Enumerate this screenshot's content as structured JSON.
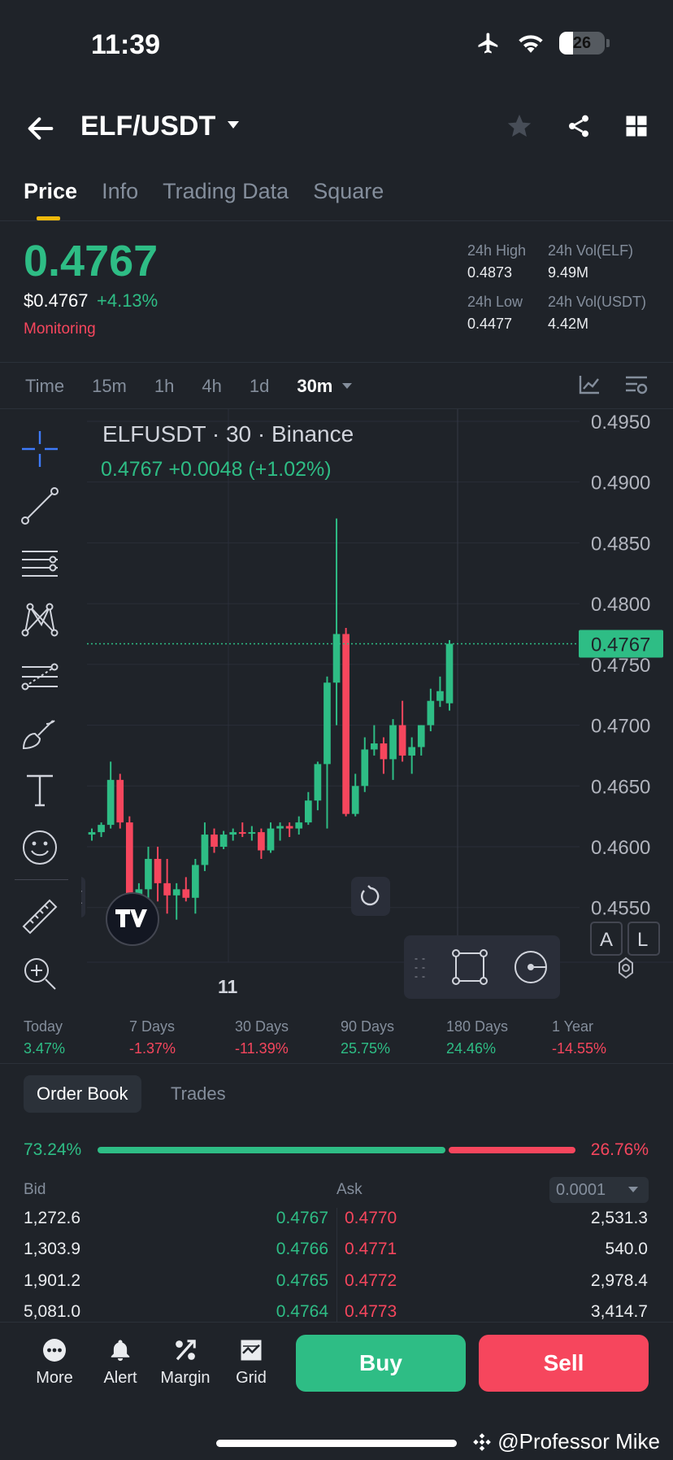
{
  "status": {
    "time": "11:39",
    "battery": "26"
  },
  "header": {
    "pair": "ELF/USDT"
  },
  "tabs": [
    "Price",
    "Info",
    "Trading Data",
    "Square"
  ],
  "price": {
    "last": "0.4767",
    "usd": "$0.4767",
    "change": "+4.13%",
    "monitoring": "Monitoring",
    "high_label": "24h High",
    "high": "0.4873",
    "low_label": "24h Low",
    "low": "0.4477",
    "vol_elf_label": "24h Vol(ELF)",
    "vol_elf": "9.49M",
    "vol_usdt_label": "24h Vol(USDT)",
    "vol_usdt": "4.42M"
  },
  "intervals": [
    "Time",
    "15m",
    "1h",
    "4h",
    "1d",
    "30m"
  ],
  "chart_meta": {
    "title": "ELFUSDT · 30 · Binance",
    "change": "0.4767  +0.0048 (+1.02%)",
    "x_tick": "11",
    "price_tag": "0.4767",
    "btn_a": "A",
    "btn_l": "L"
  },
  "chart_data": {
    "type": "candlestick",
    "title": "ELFUSDT · 30 · Binance",
    "ylim": [
      0.4505,
      0.496
    ],
    "y_ticks": [
      "0.4950",
      "0.4900",
      "0.4850",
      "0.4800",
      "0.4750",
      "0.4700",
      "0.4650",
      "0.4600",
      "0.4550"
    ],
    "x_tick_labels": [
      "11"
    ],
    "last_price": 0.4767,
    "candles": [
      [
        0.461,
        0.4615,
        0.4605,
        0.4612
      ],
      [
        0.4612,
        0.462,
        0.4608,
        0.4618
      ],
      [
        0.4618,
        0.467,
        0.4615,
        0.4655
      ],
      [
        0.4655,
        0.466,
        0.4615,
        0.462
      ],
      [
        0.462,
        0.4625,
        0.453,
        0.4545
      ],
      [
        0.4545,
        0.457,
        0.454,
        0.4565
      ],
      [
        0.4565,
        0.46,
        0.455,
        0.459
      ],
      [
        0.459,
        0.46,
        0.4555,
        0.457
      ],
      [
        0.457,
        0.459,
        0.4545,
        0.456
      ],
      [
        0.456,
        0.457,
        0.454,
        0.4565
      ],
      [
        0.4565,
        0.4575,
        0.4555,
        0.4558
      ],
      [
        0.4558,
        0.459,
        0.4545,
        0.4585
      ],
      [
        0.4585,
        0.462,
        0.458,
        0.461
      ],
      [
        0.461,
        0.4615,
        0.4595,
        0.46
      ],
      [
        0.46,
        0.4613,
        0.4598,
        0.461
      ],
      [
        0.461,
        0.4615,
        0.4605,
        0.4612
      ],
      [
        0.4612,
        0.462,
        0.4608,
        0.4611
      ],
      [
        0.4611,
        0.4617,
        0.4605,
        0.4612
      ],
      [
        0.4612,
        0.4615,
        0.459,
        0.4597
      ],
      [
        0.4597,
        0.462,
        0.4595,
        0.4615
      ],
      [
        0.4615,
        0.462,
        0.4605,
        0.4617
      ],
      [
        0.4617,
        0.462,
        0.4608,
        0.4615
      ],
      [
        0.4615,
        0.4625,
        0.461,
        0.462
      ],
      [
        0.462,
        0.4645,
        0.4618,
        0.4638
      ],
      [
        0.4638,
        0.467,
        0.463,
        0.4668
      ],
      [
        0.4668,
        0.474,
        0.4615,
        0.4735
      ],
      [
        0.4735,
        0.487,
        0.47,
        0.4775
      ],
      [
        0.4775,
        0.478,
        0.4625,
        0.4627
      ],
      [
        0.4627,
        0.466,
        0.4625,
        0.465
      ],
      [
        0.465,
        0.469,
        0.4645,
        0.468
      ],
      [
        0.468,
        0.47,
        0.4675,
        0.4685
      ],
      [
        0.4685,
        0.469,
        0.466,
        0.4672
      ],
      [
        0.4672,
        0.4705,
        0.4655,
        0.47
      ],
      [
        0.47,
        0.472,
        0.467,
        0.4675
      ],
      [
        0.4675,
        0.469,
        0.466,
        0.4682
      ],
      [
        0.4682,
        0.47,
        0.4675,
        0.47
      ],
      [
        0.47,
        0.473,
        0.4695,
        0.472
      ],
      [
        0.472,
        0.474,
        0.4715,
        0.4728
      ],
      [
        0.4718,
        0.477,
        0.4712,
        0.4767
      ]
    ]
  },
  "periods": [
    {
      "label": "Today",
      "value": "3.47%",
      "up": true
    },
    {
      "label": "7 Days",
      "value": "-1.37%",
      "up": false
    },
    {
      "label": "30 Days",
      "value": "-11.39%",
      "up": false
    },
    {
      "label": "90 Days",
      "value": "25.75%",
      "up": true
    },
    {
      "label": "180 Days",
      "value": "24.46%",
      "up": true
    },
    {
      "label": "1 Year",
      "value": "-14.55%",
      "up": false
    }
  ],
  "orderbook": {
    "tab_active": "Order Book",
    "tab_other": "Trades",
    "bid_pct": "73.24%",
    "ask_pct": "26.76%",
    "bid_ratio": 0.7324,
    "bid_label": "Bid",
    "ask_label": "Ask",
    "precision": "0.0001",
    "rows": [
      {
        "bid_qty": "1,272.6",
        "bid_price": "0.4767",
        "ask_price": "0.4770",
        "ask_qty": "2,531.3"
      },
      {
        "bid_qty": "1,303.9",
        "bid_price": "0.4766",
        "ask_price": "0.4771",
        "ask_qty": "540.0"
      },
      {
        "bid_qty": "1,901.2",
        "bid_price": "0.4765",
        "ask_price": "0.4772",
        "ask_qty": "2,978.4"
      },
      {
        "bid_qty": "5,081.0",
        "bid_price": "0.4764",
        "ask_price": "0.4773",
        "ask_qty": "3,414.7"
      }
    ]
  },
  "bottom": {
    "more": "More",
    "alert": "Alert",
    "margin": "Margin",
    "grid": "Grid",
    "buy": "Buy",
    "sell": "Sell"
  },
  "watermark": "@Professor Mike"
}
